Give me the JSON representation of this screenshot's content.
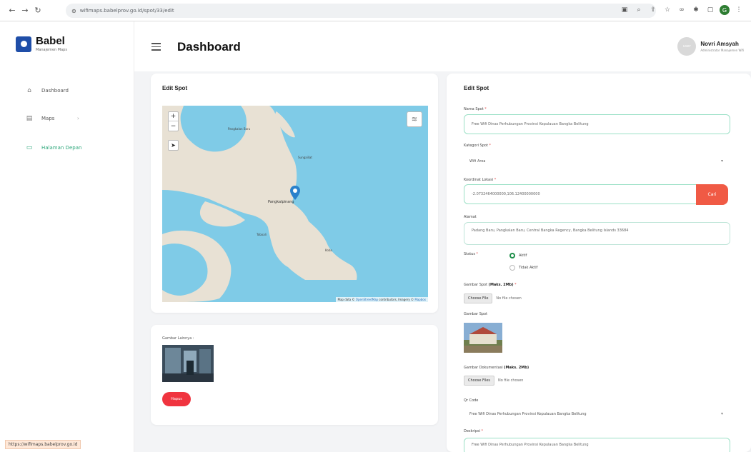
{
  "browser": {
    "url": "wifimaps.babelprov.go.id/spot/33/edit",
    "status_url": "https://wifimaps.babelprov.go.id",
    "profile_initial": "G"
  },
  "sidebar": {
    "brand_title": "Babel",
    "brand_sub": "Manajemen Maps",
    "items": [
      {
        "label": "Dashboard",
        "icon": "home-icon"
      },
      {
        "label": "Maps",
        "icon": "map-icon"
      },
      {
        "label": "Halaman Depan",
        "icon": "monitor-icon"
      }
    ]
  },
  "header": {
    "title": "Dashboard",
    "user_name": "Novri Amsyah",
    "user_role": "Administrator Manajemen Wifi",
    "avatar_text": "user"
  },
  "map_card": {
    "title": "Edit Spot",
    "zoom_in": "+",
    "zoom_out": "−",
    "attribution_prefix": "Map data ©",
    "attribution_link1": "OpenStreetMap",
    "attribution_mid": "contributors, Imagery ©",
    "attribution_link2": "Mapbox",
    "places": {
      "p1": "Pangkalan Baru",
      "p2": "Pangkalpinang",
      "p3": "Sungailiat",
      "p4": "Koba",
      "p5": "Toboali"
    }
  },
  "photo_card": {
    "label": "Gambar Lainnya :",
    "button": "Hapus"
  },
  "form": {
    "title": "Edit Spot",
    "nama_label": "Nama Spot",
    "nama_value": "Free Wifi Dinas Perhubungan Provinsi Kepulauan Bangka Belitung",
    "kategori_label": "Kategori Spot",
    "kategori_value": "Wifi Area",
    "koordinat_label": "Koordinat Lokasi",
    "koordinat_value": "-2.0732464000000,106.12400000000",
    "cari_button": "Cari",
    "alamat_label": "Alamat",
    "alamat_value": "Padang Baru, Pangkalan Baru, Central Bangka Regency, Bangka Belitung Islands 33684",
    "status_label": "Status",
    "status_options": [
      "Aktif",
      "Tidak Aktif"
    ],
    "gambar_upload_label": "Gambar Spot",
    "gambar_upload_hint": "(Maks. 2Mb)",
    "choose_file": "Choose File",
    "no_file": "No file chosen",
    "gambar_label": "Gambar Spot",
    "dokumentasi_label": "Gambar Dokumentasi",
    "dokumentasi_hint": "(Maks. 2Mb)",
    "choose_files": "Choose Files",
    "qr_label": "Qr Code",
    "qr_value": "Free Wifi Dinas Perhubungan Provinsi Kepulauan Bangka Belitung",
    "deskripsi_label": "Deskripsi",
    "deskripsi_value": "Free Wifi Dinas Perhubungan Provinsi Kepulauan Bangka Belitung"
  }
}
